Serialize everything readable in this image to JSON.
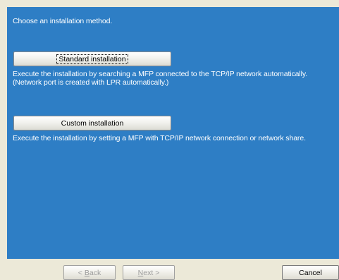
{
  "instruction": "Choose an installation method.",
  "options": {
    "standard": {
      "label": "Standard installation",
      "description_line1": "Execute the installation by searching a MFP connected to the TCP/IP network automatically.",
      "description_line2": "(Network port is created with LPR automatically.)"
    },
    "custom": {
      "label": "Custom installation",
      "description_line1": "Execute the installation by setting a MFP with TCP/IP network connection or network share."
    }
  },
  "navigation": {
    "back": {
      "prefix": "< ",
      "accel": "B",
      "rest": "ack",
      "enabled": false
    },
    "next": {
      "accel": "N",
      "rest": "ext >",
      "enabled": false
    },
    "cancel": {
      "label": "Cancel",
      "enabled": true
    }
  },
  "colors": {
    "panel_background": "#2e7ec5",
    "panel_text": "#ffffff",
    "window_background": "#ece9d8",
    "disabled_text": "#9d9d9d"
  }
}
